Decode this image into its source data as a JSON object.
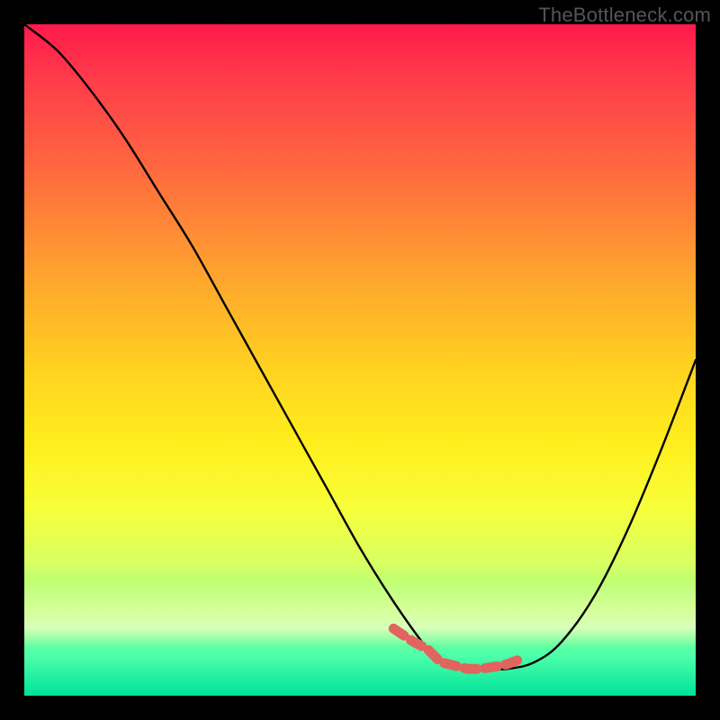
{
  "watermark": "TheBottleneck.com",
  "colors": {
    "frame": "#000000",
    "curve": "#000000",
    "marker": "#e2645e",
    "gradient_top": "#ff1a4b",
    "gradient_bottom": "#00e29a"
  },
  "chart_data": {
    "type": "line",
    "title": "",
    "xlabel": "",
    "ylabel": "",
    "xlim": [
      0,
      100
    ],
    "ylim": [
      0,
      100
    ],
    "series": [
      {
        "name": "bottleneck-curve",
        "x": [
          0,
          5,
          10,
          15,
          20,
          25,
          30,
          35,
          40,
          45,
          50,
          55,
          60,
          62,
          65,
          68,
          72,
          76,
          80,
          85,
          90,
          95,
          100
        ],
        "values": [
          100,
          96,
          90,
          83,
          75,
          67,
          58,
          49,
          40,
          31,
          22,
          14,
          7,
          5,
          4,
          4,
          4,
          5,
          8,
          15,
          25,
          37,
          50
        ]
      }
    ],
    "markers": {
      "name": "highlight-segment",
      "x": [
        55,
        58,
        60,
        62,
        64,
        66,
        68,
        70,
        72,
        74
      ],
      "values": [
        10,
        8,
        7,
        5,
        4.5,
        4,
        4,
        4.3,
        4.7,
        5.5
      ]
    },
    "annotations": []
  }
}
